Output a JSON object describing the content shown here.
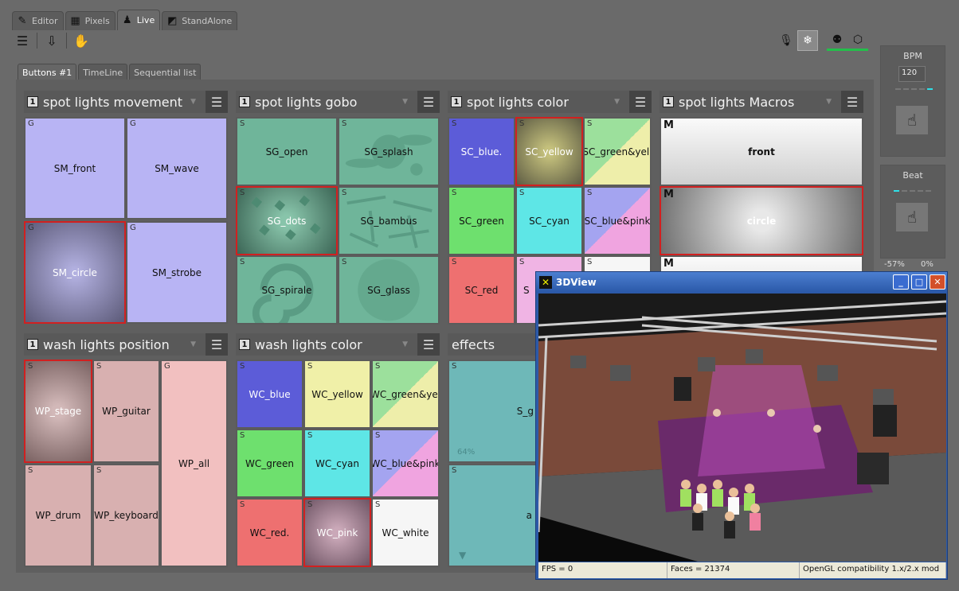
{
  "mode_tabs": [
    {
      "label": "Editor",
      "icon": "editor-icon"
    },
    {
      "label": "Pixels",
      "icon": "pixels-icon"
    },
    {
      "label": "Live",
      "icon": "live-icon"
    },
    {
      "label": "StandAlone",
      "icon": "standalone-icon"
    }
  ],
  "toolbar": {
    "menu": "menu-icon",
    "export": "export-icon",
    "hand": "hand-icon",
    "mic": "microphone-icon",
    "freeze": "snowflake-icon",
    "dmx": "dmx-icon",
    "cube": "cube-icon"
  },
  "page_tabs": [
    "Buttons #1",
    "TimeLine",
    "Sequential list"
  ],
  "groups": {
    "spot_move": {
      "num": "1",
      "title": "spot lights movement"
    },
    "spot_gobo": {
      "num": "1",
      "title": "spot lights gobo"
    },
    "spot_color": {
      "num": "1",
      "title": "spot lights color"
    },
    "spot_macros": {
      "num": "1",
      "title": "spot lights Macros"
    },
    "wash_pos": {
      "num": "1",
      "title": "wash lights position"
    },
    "wash_color": {
      "num": "1",
      "title": "wash lights color"
    },
    "effects": {
      "title": "effects"
    }
  },
  "buttons": {
    "sm_front": {
      "tag": "G",
      "label": "SM_front"
    },
    "sm_wave": {
      "tag": "G",
      "label": "SM_wave"
    },
    "sm_circle": {
      "tag": "G",
      "label": "SM_circle"
    },
    "sm_strobe": {
      "tag": "G",
      "label": "SM_strobe"
    },
    "sg_open": {
      "tag": "S",
      "label": "SG_open"
    },
    "sg_splash": {
      "tag": "S",
      "label": "SG_splash"
    },
    "sg_dots": {
      "tag": "S",
      "label": "SG_dots"
    },
    "sg_bambus": {
      "tag": "S",
      "label": "SG_bambus"
    },
    "sg_spirale": {
      "tag": "S",
      "label": "SG_spirale"
    },
    "sg_glass": {
      "tag": "S",
      "label": "SG_glass"
    },
    "sc_blue": {
      "tag": "S",
      "label": "SC_blue."
    },
    "sc_yellow": {
      "tag": "S",
      "label": "SC_yellow"
    },
    "sc_green_yell": {
      "tag": "S",
      "label": "SC_green&yell"
    },
    "sc_green": {
      "tag": "S",
      "label": "SC_green"
    },
    "sc_cyan": {
      "tag": "S",
      "label": "SC_cyan"
    },
    "sc_blue_pink": {
      "tag": "S",
      "label": "SC_blue&pink"
    },
    "sc_red": {
      "tag": "S",
      "label": "SC_red"
    },
    "sc_pink_partial": {
      "tag": "S",
      "label": "S"
    },
    "sc_white_partial": {
      "tag": "S",
      "label": ""
    },
    "m_front": {
      "tag": "M",
      "label": "front"
    },
    "m_circle": {
      "tag": "M",
      "label": "circle"
    },
    "m_third": {
      "tag": "M",
      "label": ""
    },
    "wp_stage": {
      "tag": "S",
      "label": "WP_stage"
    },
    "wp_guitar": {
      "tag": "S",
      "label": "WP_guitar"
    },
    "wp_all": {
      "tag": "G",
      "label": "WP_all"
    },
    "wp_drum": {
      "tag": "S",
      "label": "WP_drum"
    },
    "wp_keyboard": {
      "tag": "S",
      "label": "WP_keyboard"
    },
    "wc_blue": {
      "tag": "S",
      "label": "WC_blue"
    },
    "wc_yellow": {
      "tag": "S",
      "label": "WC_yellow"
    },
    "wc_green_yell": {
      "tag": "S",
      "label": "WC_green&yel"
    },
    "wc_green": {
      "tag": "S",
      "label": "WC_green"
    },
    "wc_cyan": {
      "tag": "S",
      "label": "WC_cyan"
    },
    "wc_blue_pink": {
      "tag": "S",
      "label": "WC_blue&pink"
    },
    "wc_red": {
      "tag": "S",
      "label": "WC_red."
    },
    "wc_pink": {
      "tag": "S",
      "label": "WC_pink"
    },
    "wc_white": {
      "tag": "S",
      "label": "WC_white"
    },
    "fx_1": {
      "tag": "S",
      "label": "S_g",
      "percent": "64%"
    },
    "fx_2": {
      "tag": "S",
      "label": "a"
    }
  },
  "right_panel": {
    "bpm_title": "BPM",
    "bpm_value": "120",
    "beat_title": "Beat",
    "pct_left": "-57%",
    "pct_right": "0%"
  },
  "view3d": {
    "title": "3DView",
    "fps": "FPS = 0",
    "faces": "Faces = 21374",
    "opengl": "OpenGL compatibility 1.x/2.x mod"
  },
  "colors": {
    "selected_border": "#d12020",
    "accent_green": "#22c04a",
    "accent_cyan": "#2ee0e8"
  }
}
